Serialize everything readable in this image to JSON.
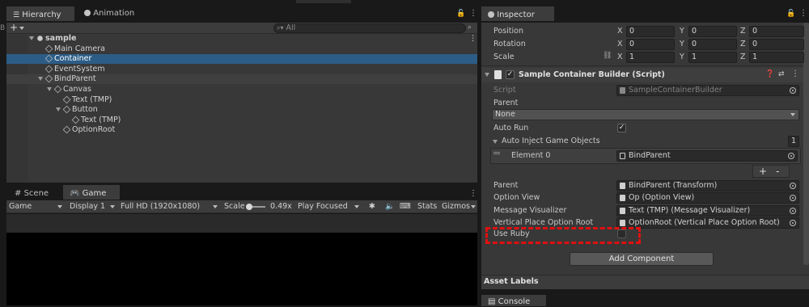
{
  "hierarchy": {
    "tab_label": "Hierarchy",
    "tab2_label": "Animation",
    "search_placeholder": "All",
    "tree": [
      {
        "label": "sample",
        "depth": 0,
        "expanded": true,
        "scene": true
      },
      {
        "label": "Main Camera",
        "depth": 1
      },
      {
        "label": "Container",
        "depth": 1,
        "selected": true
      },
      {
        "label": "EventSystem",
        "depth": 1
      },
      {
        "label": "BindParent",
        "depth": 1,
        "expanded": true
      },
      {
        "label": "Canvas",
        "depth": 2,
        "expanded": true
      },
      {
        "label": "Text (TMP)",
        "depth": 3
      },
      {
        "label": "Button",
        "depth": 3,
        "expanded": true
      },
      {
        "label": "Text (TMP)",
        "depth": 4
      },
      {
        "label": "OptionRoot",
        "depth": 3
      }
    ]
  },
  "scene_tab": "Scene",
  "game": {
    "tab_label": "Game",
    "display_mode": "Game",
    "display": "Display 1",
    "resolution": "Full HD (1920x1080)",
    "scale_label": "Scale",
    "scale_value": "0.49x",
    "play_mode": "Play Focused",
    "stats": "Stats",
    "gizmos": "Gizmos"
  },
  "inspector": {
    "tab_label": "Inspector",
    "transform": {
      "position_label": "Position",
      "rotation_label": "Rotation",
      "scale_label": "Scale",
      "position": [
        "0",
        "0",
        "0"
      ],
      "rotation": [
        "0",
        "0",
        "0"
      ],
      "scale": [
        "1",
        "1",
        "1"
      ],
      "axes": [
        "X",
        "Y",
        "Z"
      ]
    },
    "component_title": "Sample Container Builder (Script)",
    "script_label": "Script",
    "script_value": "SampleContainerBuilder",
    "parent_label": "Parent",
    "parent_dropdown": "None",
    "auto_run_label": "Auto Run",
    "auto_inject_label": "Auto Inject Game Objects",
    "auto_inject_count": "1",
    "element0_label": "Element 0",
    "element0_value": "BindParent",
    "plus_label": "+",
    "minus_label": "-",
    "parent2_label": "Parent",
    "parent2_value": "BindParent (Transform)",
    "option_view_label": "Option View",
    "option_view_value": "Op (Option View)",
    "message_visualizer_label": "Message Visualizer",
    "message_visualizer_value": "Text (TMP) (Message Visualizer)",
    "vertical_place_label": "Vertical Place Option Root",
    "vertical_place_value": "OptionRoot (Vertical Place Option Root)",
    "use_ruby_label": "Use Ruby",
    "add_component_label": "Add Component",
    "asset_labels": "Asset Labels"
  },
  "console_tab": "Console",
  "colors": {
    "selection": "#2c5d87",
    "highlight_box": "#e01010",
    "panel": "#383838"
  }
}
